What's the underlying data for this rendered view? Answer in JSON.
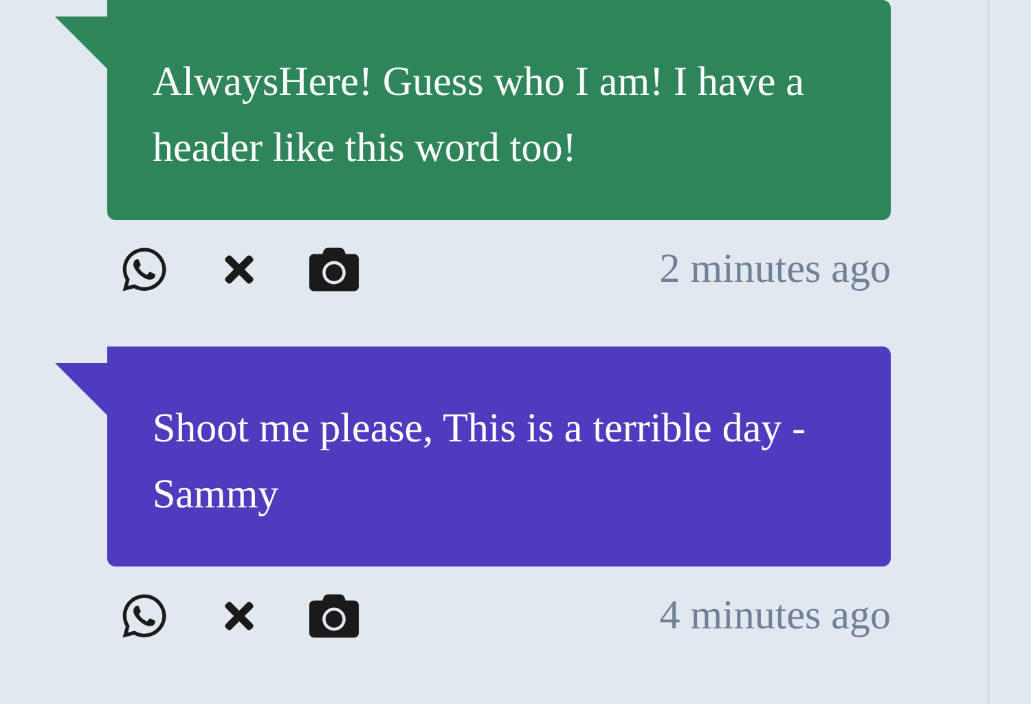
{
  "messages": [
    {
      "text": "AlwaysHere! Guess who I am! I have a header like this word too!",
      "color": "#2f855a",
      "time": "2 minutes ago"
    },
    {
      "text": "Shoot me please, This is a terrible day -Sammy",
      "color": "#4f3bbd",
      "time": "4 minutes ago"
    }
  ]
}
